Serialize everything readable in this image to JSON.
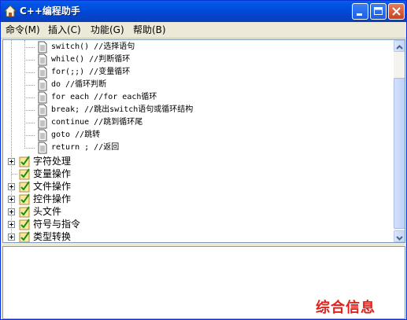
{
  "window": {
    "title": "C++编程助手"
  },
  "menu": [
    {
      "label": "命令(M)"
    },
    {
      "label": "插入(C)"
    },
    {
      "label": "功能(G)"
    },
    {
      "label": "帮助(B)"
    }
  ],
  "tree": {
    "children": [
      {
        "label": "switch() //选择语句"
      },
      {
        "label": "while() //判断循环"
      },
      {
        "label": "for(;;) //变量循环"
      },
      {
        "label": "do //循环判断"
      },
      {
        "label": "for each //for each循环"
      },
      {
        "label": "break; //跳出switch语句或循环结构"
      },
      {
        "label": "continue //跳到循环尾"
      },
      {
        "label": "goto //跳转"
      },
      {
        "label": "return ; //返回"
      }
    ],
    "categories": [
      {
        "label": "字符处理",
        "expandable": true
      },
      {
        "label": "变量操作",
        "expandable": false
      },
      {
        "label": "文件操作",
        "expandable": true
      },
      {
        "label": "控件操作",
        "expandable": true
      },
      {
        "label": "头文件",
        "expandable": true
      },
      {
        "label": "符号与指令",
        "expandable": true
      },
      {
        "label": "类型转换",
        "expandable": true
      }
    ]
  },
  "watermark": "综合信息",
  "colors": {
    "titlebar": "#0055e5",
    "watermark": "#e0201a"
  }
}
